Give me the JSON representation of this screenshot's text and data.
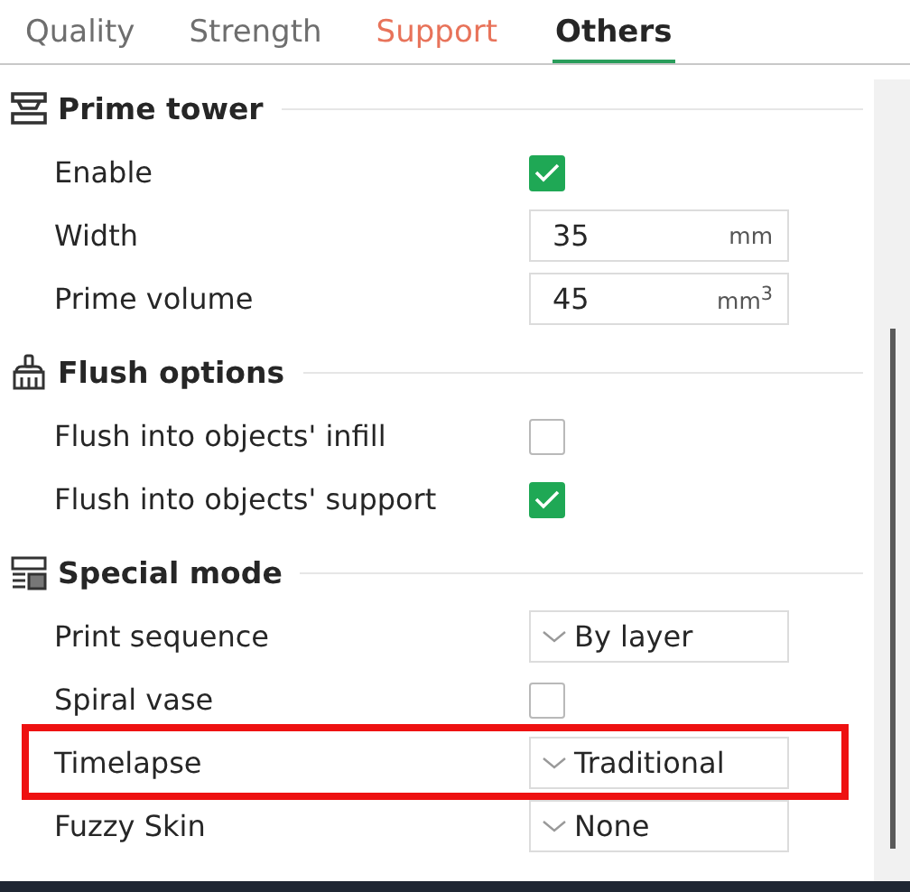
{
  "tabs": [
    {
      "label": "Quality",
      "selected": false,
      "color": "#6e6e6e"
    },
    {
      "label": "Strength",
      "selected": false,
      "color": "#6e6e6e"
    },
    {
      "label": "Support",
      "selected": false,
      "color": "#e8735a"
    },
    {
      "label": "Others",
      "selected": true,
      "color": "#262626"
    }
  ],
  "sections": [
    {
      "title": "Prime tower",
      "kind": "tower",
      "rows": [
        {
          "label": "Enable",
          "kind": "checkbox",
          "checked": true,
          "highlighted": false
        },
        {
          "label": "Width",
          "kind": "number",
          "value": "35",
          "unit": "mm",
          "highlighted": false
        },
        {
          "label": "Prime volume",
          "kind": "number",
          "value": "45",
          "unit": "mm$^{3}$",
          "highlighted": false
        }
      ]
    },
    {
      "title": "Flush options",
      "kind": "flush",
      "rows": [
        {
          "label": "Flush into objects' infill",
          "kind": "checkbox",
          "checked": false,
          "highlighted": false
        },
        {
          "label": "Flush into objects' support",
          "kind": "checkbox",
          "checked": true,
          "highlighted": false
        }
      ]
    },
    {
      "title": "Special mode",
      "kind": "mode",
      "rows": [
        {
          "label": "Print sequence",
          "kind": "select",
          "value": "By layer",
          "highlighted": false
        },
        {
          "label": "Spiral vase",
          "kind": "checkbox",
          "checked": false,
          "highlighted": false
        },
        {
          "label": "Timelapse",
          "kind": "select",
          "value": "Traditional",
          "highlighted": true
        },
        {
          "label": "Fuzzy Skin",
          "kind": "select",
          "value": "None",
          "highlighted": false
        }
      ]
    }
  ]
}
